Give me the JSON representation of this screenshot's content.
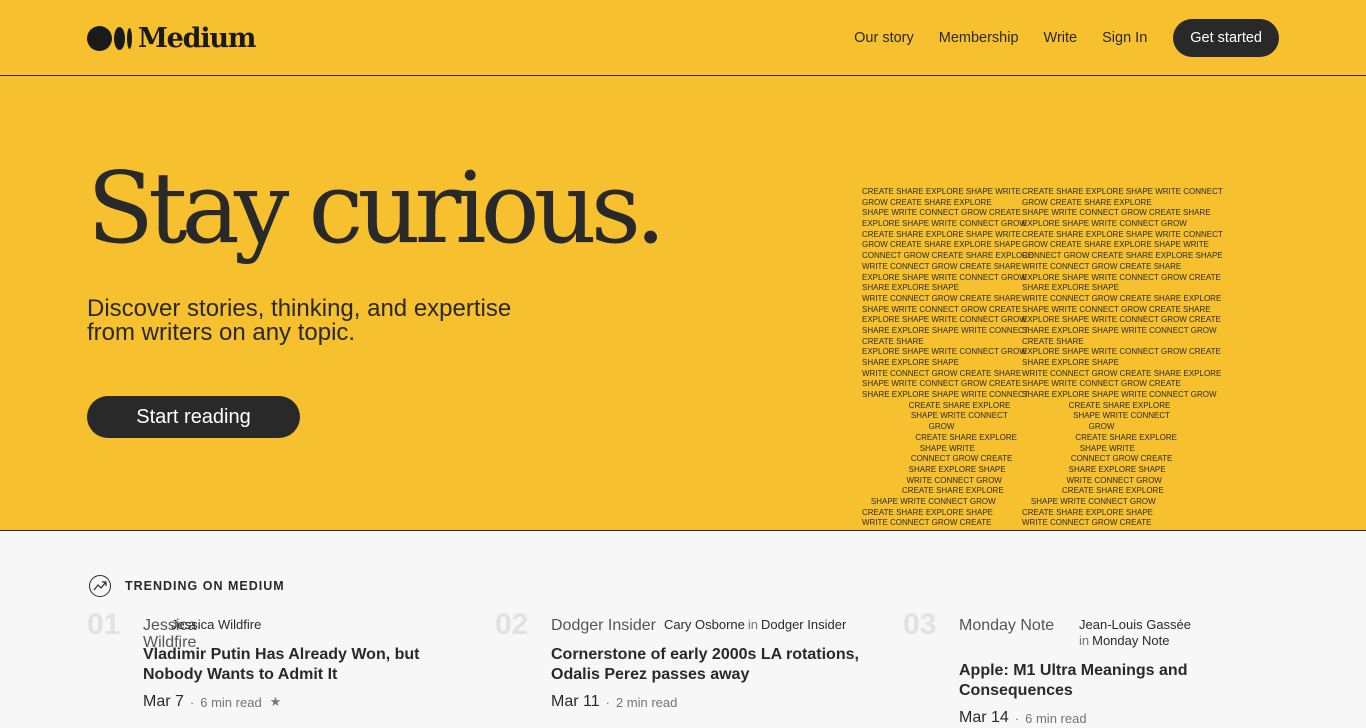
{
  "header": {
    "brand": "Medium",
    "nav": [
      "Our story",
      "Membership",
      "Write",
      "Sign In"
    ],
    "cta": "Get started"
  },
  "hero": {
    "title": "Stay curious.",
    "subtitle": "Discover stories, thinking, and expertise from writers on any topic.",
    "button": "Start reading",
    "art_left": [
      "CREATE SHARE EXPLORE SHAPE WRITE",
      "GROW CREATE SHARE EXPLORE",
      "SHAPE WRITE CONNECT GROW CREATE",
      "EXPLORE SHAPE WRITE CONNECT GROW",
      "CREATE SHARE EXPLORE SHAPE WRITE",
      "GROW CREATE SHARE EXPLORE SHAPE",
      "CONNECT GROW CREATE SHARE EXPLORE",
      "WRITE CONNECT GROW CREATE SHARE",
      "EXPLORE SHAPE WRITE CONNECT GROW",
      "SHARE EXPLORE SHAPE",
      "WRITE CONNECT GROW CREATE SHARE",
      "SHAPE WRITE CONNECT GROW CREATE",
      "EXPLORE SHAPE WRITE CONNECT GROW",
      "SHARE EXPLORE SHAPE WRITE CONNECT",
      "CREATE SHARE",
      "EXPLORE SHAPE WRITE CONNECT GROW",
      "SHARE EXPLORE SHAPE",
      "WRITE CONNECT GROW CREATE SHARE",
      "SHAPE WRITE CONNECT GROW CREATE",
      "SHARE EXPLORE SHAPE WRITE CONNECT",
      "                     CREATE SHARE EXPLORE",
      "                      SHAPE WRITE CONNECT",
      "                              GROW",
      "                        CREATE SHARE EXPLORE",
      "                          SHAPE WRITE",
      "                      CONNECT GROW CREATE",
      "                     SHARE EXPLORE SHAPE",
      "                    WRITE CONNECT GROW",
      "                  CREATE SHARE EXPLORE",
      "    SHAPE WRITE CONNECT GROW",
      "CREATE SHARE EXPLORE SHAPE",
      "WRITE CONNECT GROW CREATE"
    ],
    "art_right": [
      "CREATE SHARE EXPLORE SHAPE WRITE CONNECT",
      "GROW CREATE SHARE EXPLORE",
      "SHAPE WRITE CONNECT GROW CREATE SHARE",
      "EXPLORE SHAPE WRITE CONNECT GROW",
      "CREATE SHARE EXPLORE SHAPE WRITE CONNECT",
      "GROW CREATE SHARE EXPLORE SHAPE WRITE",
      "CONNECT GROW CREATE SHARE EXPLORE SHAPE",
      "WRITE CONNECT GROW CREATE SHARE",
      "EXPLORE SHAPE WRITE CONNECT GROW CREATE",
      "SHARE EXPLORE SHAPE",
      "WRITE CONNECT GROW CREATE SHARE EXPLORE",
      "SHAPE WRITE CONNECT GROW CREATE SHARE",
      "EXPLORE SHAPE WRITE CONNECT GROW CREATE",
      "SHARE EXPLORE SHAPE WRITE CONNECT GROW",
      "CREATE SHARE",
      "EXPLORE SHAPE WRITE CONNECT GROW CREATE",
      "SHARE EXPLORE SHAPE",
      "WRITE CONNECT GROW CREATE SHARE EXPLORE",
      "SHAPE WRITE CONNECT GROW CREATE",
      "SHARE EXPLORE SHAPE WRITE CONNECT GROW",
      "                     CREATE SHARE EXPLORE",
      "                       SHAPE WRITE CONNECT",
      "                              GROW",
      "                        CREATE SHARE EXPLORE",
      "                          SHAPE WRITE",
      "                      CONNECT GROW CREATE",
      "                     SHARE EXPLORE SHAPE",
      "                    WRITE CONNECT GROW",
      "                  CREATE SHARE EXPLORE",
      "    SHAPE WRITE CONNECT GROW",
      "CREATE SHARE EXPLORE SHAPE",
      "WRITE CONNECT GROW CREATE"
    ]
  },
  "trending": {
    "label": "TRENDING ON MEDIUM",
    "items": [
      {
        "num": "01",
        "avatar_alt": "Jessica Wildfire",
        "author": "Jessica Wildfire",
        "in_word": "",
        "publication": "",
        "title": "Vladimir Putin Has Already Won, but Nobody Wants to Admit It",
        "date": "Mar 7",
        "read": "6 min read",
        "star": "★"
      },
      {
        "num": "02",
        "avatar_alt": "Dodger Insider",
        "author": "Cary Osborne",
        "in_word": "in",
        "publication": "Dodger Insider",
        "title": "Cornerstone of early 2000s LA rotations, Odalis Perez passes away",
        "date": "Mar 11",
        "read": "2 min read",
        "star": ""
      },
      {
        "num": "03",
        "avatar_alt": "Monday Note",
        "author": "Jean-Louis Gassée",
        "in_word": "in",
        "publication": "Monday Note",
        "title": "Apple: M1 Ultra Meanings and Consequences",
        "date": "Mar 14",
        "read": "6 min read",
        "star": ""
      }
    ]
  }
}
